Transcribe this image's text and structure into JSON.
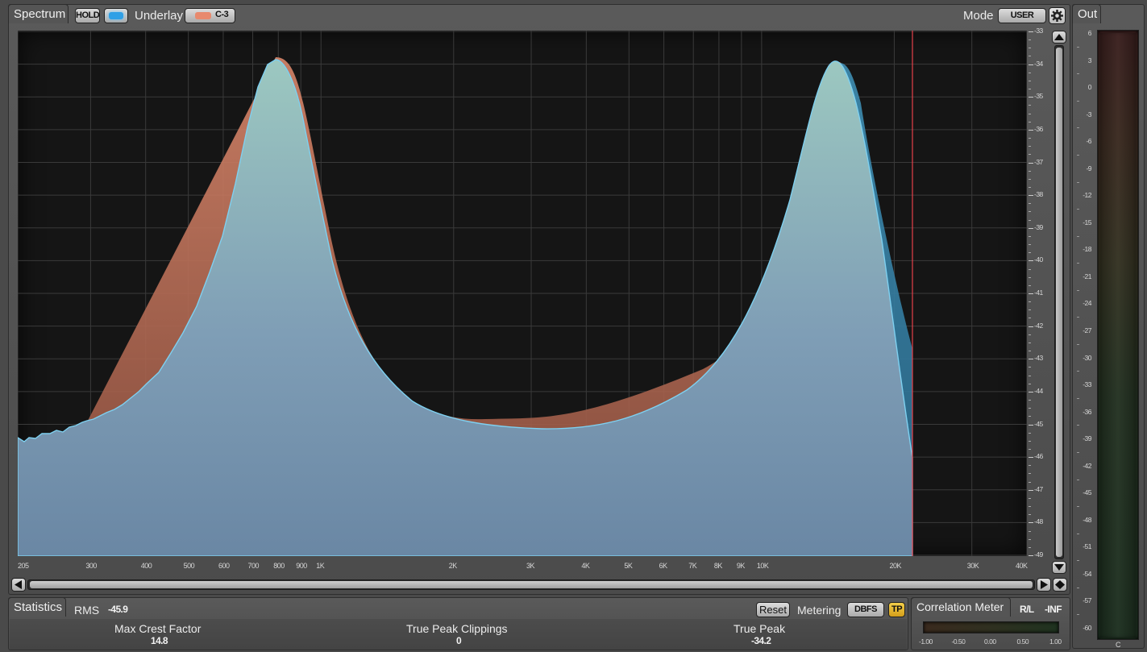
{
  "spectrum": {
    "tab_label": "Spectrum",
    "hold_label": "HOLD",
    "underlay_label": "Underlay",
    "underlay_value": "C-3",
    "mode_label": "Mode",
    "mode_value": "USER",
    "colors": {
      "hold_led": "#2fa0e6",
      "underlay_led": "#e88a6e",
      "cursor_line": "#e5404a",
      "live_fill": "#8fb6cc",
      "underlay_fill": "#d98466"
    },
    "db_ticks": [
      "-33",
      "-34",
      "-35",
      "-36",
      "-37",
      "-38",
      "-39",
      "-40",
      "-41",
      "-42",
      "-43",
      "-44",
      "-45",
      "-46",
      "-47",
      "-48",
      "-49"
    ],
    "freq_ticks": [
      "205",
      "300",
      "400",
      "500",
      "600",
      "700",
      "800",
      "900",
      "1K",
      "2K",
      "3K",
      "4K",
      "5K",
      "6K",
      "7K",
      "8K",
      "9K",
      "10K",
      "20K",
      "30K",
      "40K"
    ]
  },
  "output": {
    "tab_label": "Out",
    "ticks": [
      "6",
      "3",
      "0",
      "-3",
      "-6",
      "-9",
      "-12",
      "-15",
      "-18",
      "-21",
      "-24",
      "-27",
      "-30",
      "-33",
      "-36",
      "-39",
      "-42",
      "-45",
      "-48",
      "-51",
      "-54",
      "-57",
      "-60"
    ],
    "channel_label": "C"
  },
  "statistics": {
    "tab_label": "Statistics",
    "rms_label": "RMS",
    "rms_value": "-45.9",
    "reset_label": "Reset",
    "metering_label": "Metering",
    "metering_value": "DBFS",
    "tp_label": "TP",
    "max_crest_label": "Max Crest Factor",
    "max_crest_value": "14.8",
    "true_peak_clippings_label": "True Peak Clippings",
    "true_peak_clippings_value": "0",
    "true_peak_label": "True Peak",
    "true_peak_value": "-34.2"
  },
  "correlation": {
    "tab_label": "Correlation Meter",
    "mode_value": "R/L",
    "value": "-INF",
    "ticks": [
      "-1.00",
      "-0.50",
      "0.00",
      "0.50",
      "1.00"
    ]
  }
}
